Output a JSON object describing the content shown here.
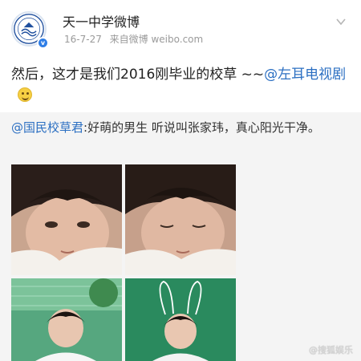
{
  "post": {
    "account_name": "天一中学微博",
    "date": "16-7-27",
    "source": "来自微博 weibo.com",
    "text_main": "然后，这才是我们2016刚毕业的校草 ~~",
    "mention": "@左耳电视剧",
    "avatar_icon": "school-logo-icon",
    "verified_icon": "verified-badge-icon"
  },
  "repost": {
    "mention": "@国民校草君",
    "text": ":好萌的男生 听说叫张家玮，真心阳光干净。"
  },
  "photos": [
    {
      "name": "photo-closeup-1"
    },
    {
      "name": "photo-closeup-2"
    },
    {
      "name": "photo-outdoor"
    },
    {
      "name": "photo-bunny-ears"
    }
  ],
  "watermark": "@搜狐娱乐",
  "colors": {
    "mention": "#2b6fc2",
    "repost_bg": "#f4f4f4",
    "meta_gray": "#9a9a9a"
  }
}
